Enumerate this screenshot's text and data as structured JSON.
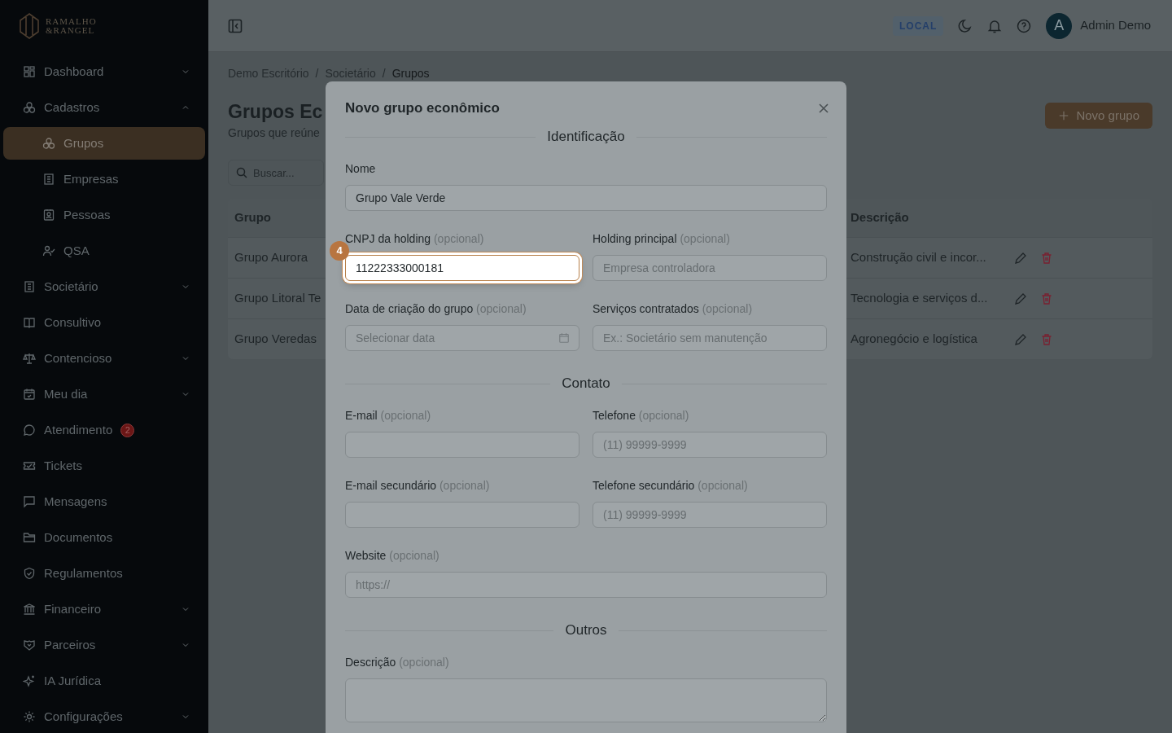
{
  "logo": {
    "line1": "RAMALHO",
    "line2": "&RANGEL"
  },
  "sidebar": {
    "items": [
      {
        "label": "Dashboard",
        "expandable": true,
        "expanded": false,
        "selected": false
      },
      {
        "label": "Cadastros",
        "expandable": true,
        "expanded": true,
        "selected": false,
        "children": [
          {
            "label": "Grupos",
            "selected": true
          },
          {
            "label": "Empresas",
            "selected": false
          },
          {
            "label": "Pessoas",
            "selected": false
          },
          {
            "label": "QSA",
            "selected": false
          }
        ]
      },
      {
        "label": "Societário",
        "expandable": true,
        "expanded": false,
        "selected": false
      },
      {
        "label": "Consultivo",
        "expandable": false,
        "selected": false
      },
      {
        "label": "Contencioso",
        "expandable": true,
        "expanded": false,
        "selected": false
      },
      {
        "label": "Meu dia",
        "expandable": true,
        "expanded": false,
        "selected": false
      },
      {
        "label": "Atendimento",
        "expandable": false,
        "selected": false,
        "badge": "2"
      },
      {
        "label": "Tickets",
        "expandable": false,
        "selected": false
      },
      {
        "label": "Mensagens",
        "expandable": false,
        "selected": false
      },
      {
        "label": "Documentos",
        "expandable": false,
        "selected": false
      },
      {
        "label": "Regulamentos",
        "expandable": false,
        "selected": false
      },
      {
        "label": "Financeiro",
        "expandable": true,
        "expanded": false,
        "selected": false
      },
      {
        "label": "Parceiros",
        "expandable": true,
        "expanded": false,
        "selected": false
      },
      {
        "label": "IA Jurídica",
        "expandable": false,
        "selected": false
      },
      {
        "label": "Configurações",
        "expandable": true,
        "expanded": false,
        "selected": false
      }
    ]
  },
  "topbar": {
    "env_badge": "LOCAL",
    "user": {
      "initial": "A",
      "name": "Admin Demo"
    }
  },
  "breadcrumb": {
    "separator": "/",
    "items": [
      "Demo Escritório",
      "Societário",
      "Grupos"
    ]
  },
  "page": {
    "title": "Grupos Ec",
    "subtitle": "Grupos que reúne",
    "search_placeholder": "Buscar...",
    "new_button": "Novo grupo"
  },
  "table": {
    "columns": [
      "Grupo",
      "Descrição"
    ],
    "rows": [
      {
        "grupo": "Grupo Aurora",
        "descricao": "Construção civil e incor..."
      },
      {
        "grupo": "Grupo Litoral Te",
        "descricao": "Tecnologia e serviços d..."
      },
      {
        "grupo": "Grupo Veredas",
        "descricao": "Agronegócio e logística"
      }
    ]
  },
  "modal": {
    "title": "Novo grupo econômico",
    "sections": [
      {
        "heading": "Identificação",
        "fields": [
          {
            "label": "Nome",
            "kind": "text",
            "wide": true,
            "value": "Grupo Vale Verde",
            "highlighted": false
          },
          {
            "label": "CNPJ da holding",
            "optional": "(opcional)",
            "kind": "text",
            "wide": false,
            "value": "11222333000181",
            "highlighted": true,
            "step": "4"
          },
          {
            "label": "Holding principal",
            "optional": "(opcional)",
            "kind": "text",
            "wide": false,
            "placeholder": "Empresa controladora",
            "highlighted": false
          },
          {
            "label": "Data de criação do grupo",
            "optional": "(opcional)",
            "kind": "date",
            "wide": false,
            "placeholder": "Selecionar data",
            "highlighted": false
          },
          {
            "label": "Serviços contratados",
            "optional": "(opcional)",
            "kind": "text",
            "wide": false,
            "placeholder": "Ex.: Societário sem manutenção",
            "highlighted": false
          }
        ]
      },
      {
        "heading": "Contato",
        "fields": [
          {
            "label": "E-mail",
            "optional": "(opcional)",
            "kind": "text",
            "wide": false,
            "highlighted": false
          },
          {
            "label": "Telefone",
            "optional": "(opcional)",
            "kind": "text",
            "wide": false,
            "placeholder": "(11) 99999-9999",
            "highlighted": false
          },
          {
            "label": "E-mail secundário",
            "optional": "(opcional)",
            "kind": "text",
            "wide": false,
            "highlighted": false
          },
          {
            "label": "Telefone secundário",
            "optional": "(opcional)",
            "kind": "text",
            "wide": false,
            "placeholder": "(11) 99999-9999",
            "highlighted": false
          },
          {
            "label": "Website",
            "optional": "(opcional)",
            "kind": "text",
            "wide": true,
            "placeholder": "https://",
            "highlighted": false
          }
        ]
      },
      {
        "heading": "Outros",
        "fields": [
          {
            "label": "Descrição",
            "optional": "(opcional)",
            "kind": "textarea",
            "wide": true,
            "highlighted": false
          }
        ]
      }
    ]
  }
}
